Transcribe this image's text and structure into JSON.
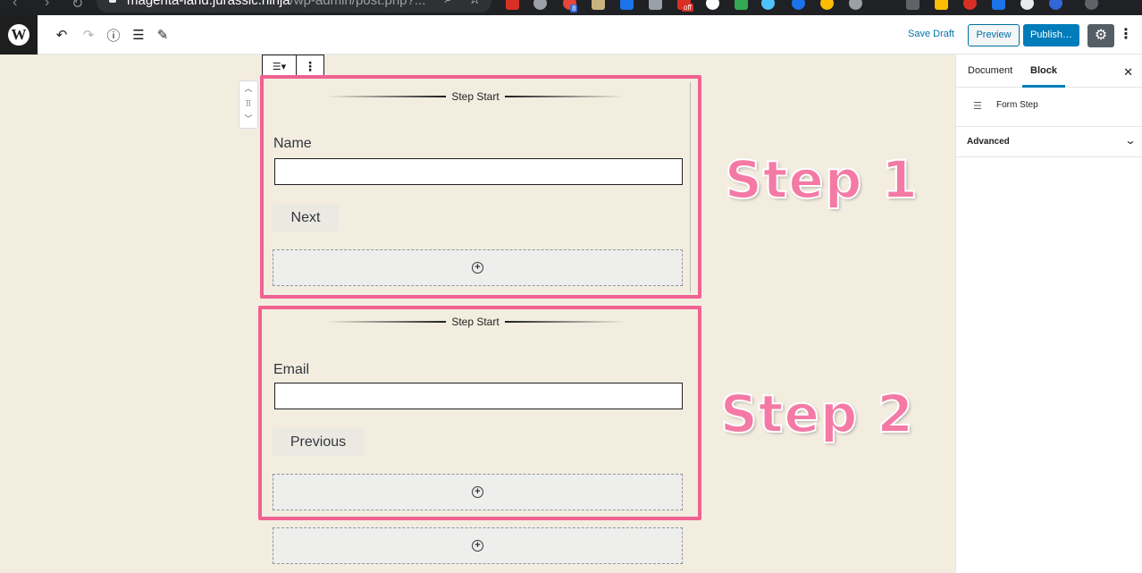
{
  "browser": {
    "url_host": "magenta-land.jurassic.ninja",
    "url_path": "/wp-admin/post.php?...",
    "badges": [
      "8",
      "off"
    ]
  },
  "toolbar": {
    "logo": "W",
    "undo_icon": "↶",
    "redo_icon": "↷",
    "info_icon": "ⓘ",
    "outline_icon": "☰",
    "edit_icon": "✎",
    "save_draft": "Save Draft",
    "preview": "Preview",
    "publish": "Publish…",
    "settings_icon": "⚙",
    "more_icon": "⋮"
  },
  "block_toolbar": {
    "type_icon": "☰▾",
    "more_icon": "⋮"
  },
  "mover": {
    "up": "︿",
    "drag": "⠿",
    "down": "﹀"
  },
  "steps": [
    {
      "divider_label": "Step Start",
      "field_label": "Name",
      "button_label": "Next",
      "annotation": "Step 1"
    },
    {
      "divider_label": "Step Start",
      "field_label": "Email",
      "button_label": "Previous",
      "annotation": "Step 2"
    }
  ],
  "appender_icon": "+",
  "sidebar": {
    "tab_document": "Document",
    "tab_block": "Block",
    "active_tab": "Block",
    "close_icon": "✕",
    "block_icon": "☰",
    "block_name": "Form Step",
    "panel_advanced": "Advanced",
    "chevron_icon": "⌄"
  },
  "colors": {
    "accent": "#007cba",
    "highlight": "#f06292",
    "annotation": "#f47aa5",
    "canvas_bg": "#f3ede0"
  }
}
